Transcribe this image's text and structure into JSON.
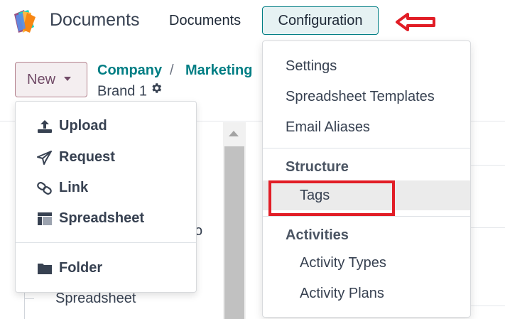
{
  "app": {
    "title": "Documents",
    "logo_icon": "odoo-documents-logo"
  },
  "navbar": {
    "items": [
      {
        "label": "Documents"
      },
      {
        "label": "Configuration",
        "active": true
      }
    ]
  },
  "control_panel": {
    "new_button_label": "New",
    "breadcrumb": {
      "items": [
        "Company",
        "Marketing"
      ],
      "separator": "/",
      "current": "Brand 1"
    }
  },
  "new_menu": {
    "items": [
      {
        "label": "Upload",
        "icon": "upload-icon"
      },
      {
        "label": "Request",
        "icon": "paper-plane-icon"
      },
      {
        "label": "Link",
        "icon": "link-icon"
      },
      {
        "label": "Spreadsheet",
        "icon": "spreadsheet-icon"
      }
    ],
    "folder_item": {
      "label": "Folder",
      "icon": "folder-icon"
    }
  },
  "config_menu": {
    "items": [
      "Settings",
      "Spreadsheet Templates",
      "Email Aliases"
    ],
    "sections": [
      {
        "header": "Structure",
        "items": [
          "Tags"
        ]
      },
      {
        "header": "Activities",
        "items": [
          "Activity Types",
          "Activity Plans"
        ]
      }
    ]
  },
  "background": {
    "fragment_text": "o",
    "tree_item": "Spreadsheet"
  },
  "colors": {
    "brand_teal": "#017e84",
    "new_button_text": "#714b67",
    "annotation_red": "#e11d26"
  }
}
